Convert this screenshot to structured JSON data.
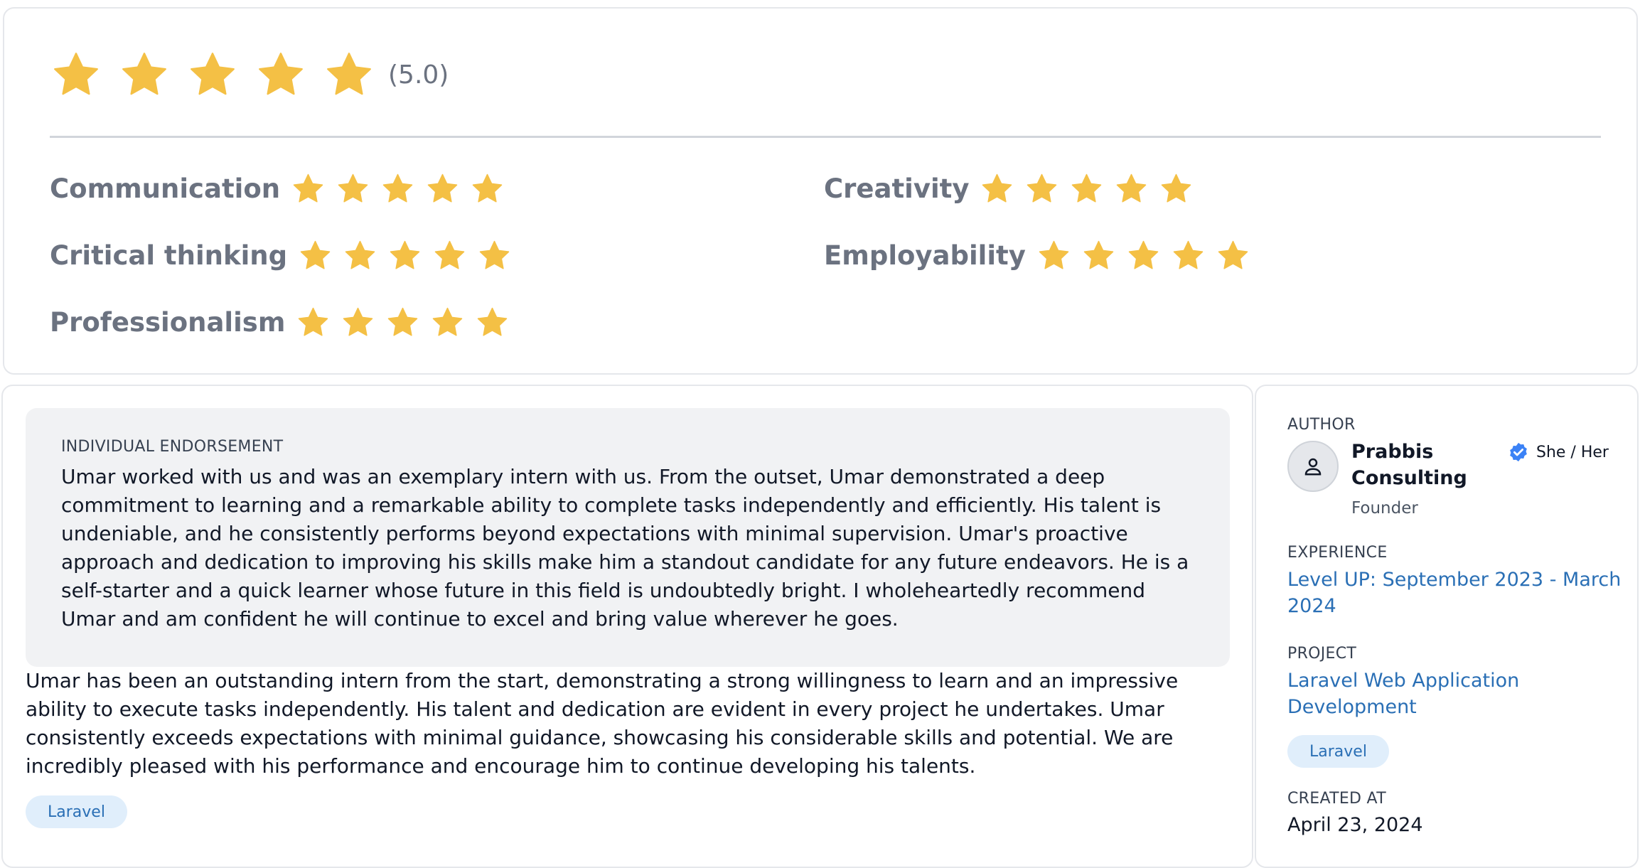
{
  "rating": {
    "overall_score": "(5.0)",
    "overall_value": 5,
    "max_value": 5,
    "star_color": "#f4c045",
    "criteria": [
      {
        "label": "Communication",
        "value": 5
      },
      {
        "label": "Critical thinking",
        "value": 5
      },
      {
        "label": "Professionalism",
        "value": 5
      },
      {
        "label": "Creativity",
        "value": 5
      },
      {
        "label": "Employability",
        "value": 5
      }
    ]
  },
  "endorsement": {
    "section_label": "INDIVIDUAL ENDORSEMENT",
    "quote": "Umar worked with us and was an exemplary intern with us. From the outset, Umar demonstrated a deep commitment to learning and a remarkable ability to complete tasks independently and efficiently. His talent is undeniable, and he consistently performs beyond expectations with minimal supervision. Umar's proactive approach and dedication to improving his skills make him a standout candidate for any future endeavors. He is a self-starter and a quick learner whose future in this field is undoubtedly bright. I wholeheartedly recommend Umar and am confident he will continue to excel and bring value wherever he goes.",
    "body": "Umar has been an outstanding intern from the start, demonstrating a strong willingness to learn and an impressive ability to execute tasks independently. His talent and dedication are evident in every project he undertakes. Umar consistently exceeds expectations with minimal guidance, showcasing his considerable skills and potential. We are incredibly pleased with his performance and encourage him to continue developing his talents.",
    "tag": "Laravel"
  },
  "meta": {
    "author_label": "AUTHOR",
    "author_name": "Prabbis Consulting",
    "author_role": "Founder",
    "pronouns": "She / Her",
    "experience_label": "EXPERIENCE",
    "experience": "Level UP: September 2023 - March 2024",
    "project_label": "PROJECT",
    "project": "Laravel Web Application Development",
    "project_tag": "Laravel",
    "created_label": "CREATED AT",
    "created_at": "April 23, 2024",
    "accent_color": "#2a6fb5",
    "verified_color": "#3b82f6"
  }
}
